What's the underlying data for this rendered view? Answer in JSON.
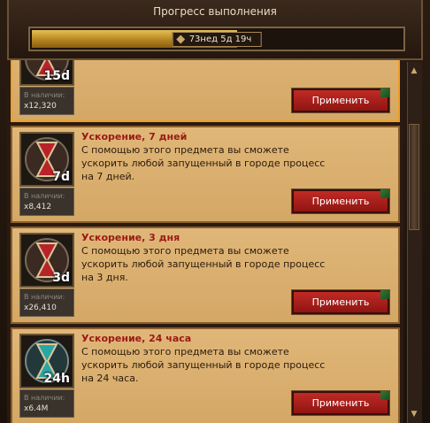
{
  "header": {
    "title": "Прогресс выполнения",
    "progress_label": "73нед 5д 19ч",
    "progress_fraction": 0.55
  },
  "items": [
    {
      "title": "",
      "description": "",
      "duration": "15d",
      "stock_label": "В наличии:",
      "stock_count": "x12,320",
      "button": "Применить",
      "glass_color": "#b8232a"
    },
    {
      "title": "Ускорение, 7 дней",
      "description": "С помощью этого предмета вы сможете ускорить любой запущенный в городе процесс на 7 дней.",
      "duration": "7d",
      "stock_label": "В наличии:",
      "stock_count": "x8,412",
      "button": "Применить",
      "glass_color": "#b8232a"
    },
    {
      "title": "Ускорение, 3 дня",
      "description": "С помощью этого предмета вы сможете ускорить любой запущенный в городе процесс на 3 дня.",
      "duration": "3d",
      "stock_label": "В наличии:",
      "stock_count": "x26,410",
      "button": "Применить",
      "glass_color": "#b8232a"
    },
    {
      "title": "Ускорение, 24 часа",
      "description": "С помощью этого предмета вы сможете ускорить любой запущенный в городе процесс на 24 часа.",
      "duration": "24h",
      "stock_label": "В наличии:",
      "stock_count": "x6.4M",
      "button": "Применить",
      "glass_color": "#2aa6a6"
    }
  ],
  "icons": {
    "scroll_up": "▲",
    "scroll_down": "▼"
  }
}
